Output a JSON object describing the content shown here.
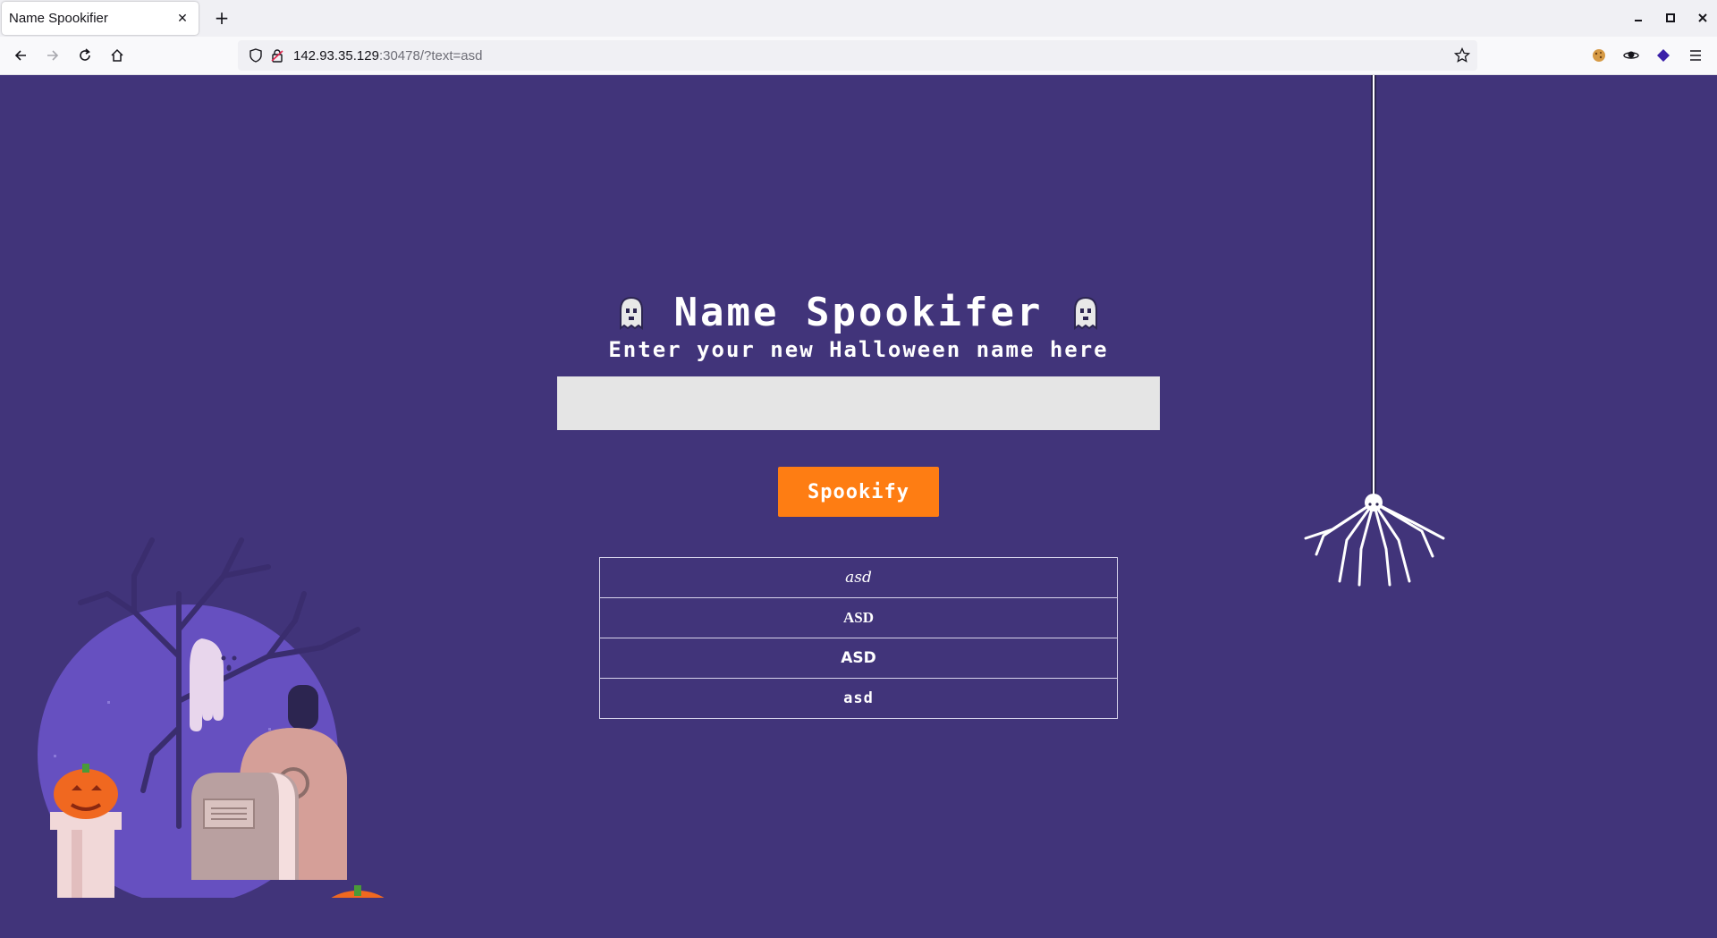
{
  "browser": {
    "tab_title": "Name Spookifier",
    "url_host": "142.93.35.129",
    "url_rest": ":30478/?text=asd"
  },
  "page": {
    "title": "Name Spookifer",
    "subtitle": "Enter your new Halloween name here",
    "input_value": "",
    "button_label": "Spookify",
    "results": [
      "asd",
      "ASD",
      "ASD",
      "asd"
    ]
  },
  "colors": {
    "background": "#41347a",
    "accent": "#fe7d13",
    "input": "#e5e5e5"
  }
}
